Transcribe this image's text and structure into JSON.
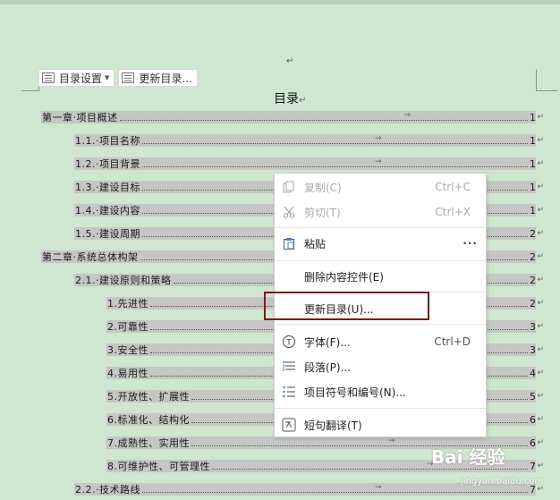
{
  "document": {
    "top_para_mark": "↵",
    "toolbar": {
      "toc_settings_label": "目录设置",
      "dropdown_arrow": "▼",
      "update_toc_label": "更新目录..."
    },
    "toc_title": "目录",
    "para_mark": "↵",
    "tab_arrow": "→",
    "entries": [
      {
        "text": "第一章·项目概述",
        "page": "1"
      },
      {
        "text": "1.1.·项目名称",
        "page": "1"
      },
      {
        "text": "1.2.·项目背景",
        "page": "1"
      },
      {
        "text": "1.3.·建设目标",
        "page": "1"
      },
      {
        "text": "1.4.·建设内容",
        "page": "1"
      },
      {
        "text": "1.5.·建设周期",
        "page": "2"
      },
      {
        "text": "第二章·系统总体构架",
        "page": "2"
      },
      {
        "text": "2.1.·建设原则和策略",
        "page": "2"
      },
      {
        "text": "1.先进性",
        "page": "2"
      },
      {
        "text": "2.可靠性",
        "page": "3"
      },
      {
        "text": "3.安全性",
        "page": "3"
      },
      {
        "text": "4.易用性",
        "page": "4"
      },
      {
        "text": "5.开放性、扩展性",
        "page": "5"
      },
      {
        "text": "6.标准化、结构化",
        "page": "6"
      },
      {
        "text": "7.成熟性、实用性",
        "page": "6"
      },
      {
        "text": "8.可维护性、可管理性",
        "page": "7"
      },
      {
        "text": "2.2.·技术路线",
        "page": "7"
      }
    ]
  },
  "context_menu": {
    "copy": {
      "label": "复制(C)",
      "shortcut": "Ctrl+C",
      "icon": "copy-icon"
    },
    "cut": {
      "label": "剪切(T)",
      "shortcut": "Ctrl+X",
      "icon": "scissors-icon"
    },
    "paste": {
      "label": "粘贴",
      "more": "···",
      "icon": "clipboard-icon"
    },
    "delete_control": {
      "label": "删除内容控件(E)"
    },
    "update_toc": {
      "label": "更新目录(U)..."
    },
    "font": {
      "label": "字体(F)...",
      "shortcut": "Ctrl+D",
      "icon": "font-icon",
      "glyph": "T"
    },
    "paragraph": {
      "label": "段落(P)...",
      "icon": "paragraph-icon"
    },
    "bullets": {
      "label": "项目符号和编号(N)...",
      "icon": "list-icon"
    },
    "translate": {
      "label": "短句翻译(T)",
      "icon": "translate-icon"
    }
  },
  "watermark": {
    "logo": "Bai 经验",
    "url": "jingyan.baidu.com"
  },
  "colors": {
    "background": "#cfe6cf",
    "toc_highlight": "#c4c7c3",
    "emphasis_box": "#7a1a1a"
  }
}
